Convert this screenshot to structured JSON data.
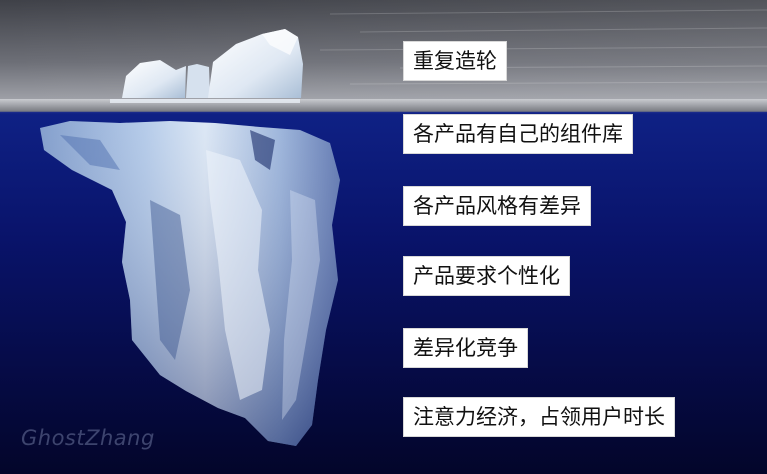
{
  "labels": [
    "重复造轮",
    "各产品有自己的组件库",
    "各产品风格有差异",
    "产品要求个性化",
    "差异化竞争",
    "注意力经济，占领用户时长"
  ],
  "watermark": "GhostZhang",
  "colors": {
    "sky_top": "#4f5158",
    "sky_bottom": "#9a9ca3",
    "water_top": "#0d1c78",
    "water_bottom": "#04062c",
    "ice": "#dbe8f7",
    "label_bg": "#ffffff",
    "label_text": "#111111"
  }
}
